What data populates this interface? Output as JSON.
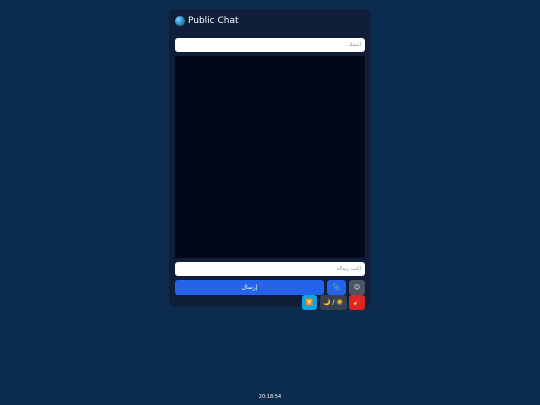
{
  "chat": {
    "title": "Public Chat",
    "name_placeholder": "اسمك",
    "message_placeholder": "اكتب رسالة",
    "send_label": "إرسال",
    "attach_label": "📎",
    "emoji_label": "😊",
    "filter_label": "🔽",
    "theme_label": "🌙 / ☀️",
    "clear_label": "🧹"
  },
  "footer": {
    "time": "20:18:54"
  },
  "colors": {
    "background": "#0b2b4f",
    "panel": "#0f1f3a",
    "messages_bg": "#020817",
    "send_button": "#2563eb",
    "clear_button": "#dc2626",
    "filter_button": "#0ea5e9"
  }
}
